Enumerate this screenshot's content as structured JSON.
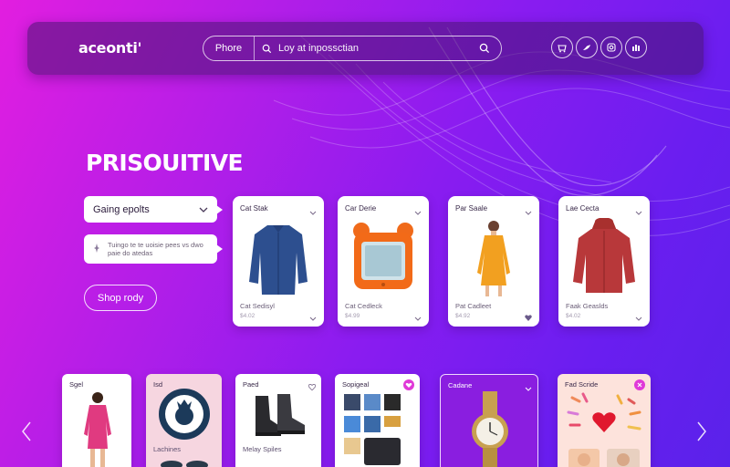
{
  "header": {
    "logo": "aceonti'",
    "search_scope": "Phore",
    "search_placeholder": "Loy at inpossctian",
    "icons": [
      "cart-icon",
      "bird-icon",
      "instagram-icon",
      "chart-icon"
    ]
  },
  "hero": {
    "title": "PRISOUITIVE",
    "select_label": "Gaing epolts",
    "note_text": "Tuingo te te uoisie pees vs dwo paie do atedas",
    "shop_button": "Shop rody"
  },
  "products": [
    {
      "title": "Cat Stak",
      "name": "Cat Sedisyl",
      "price": "$4.02",
      "icon": "blue-jacket"
    },
    {
      "title": "Car Derie",
      "name": "Cat Cedleck",
      "price": "$4.99",
      "icon": "orange-tablet"
    },
    {
      "title": "Par Saale",
      "name": "Pat Cadleet",
      "price": "$4.92",
      "icon": "orange-dress"
    },
    {
      "title": "Lae Cecta",
      "name": "Faak Geaslds",
      "price": "$4.02",
      "icon": "red-hoodie"
    }
  ],
  "bottom_cards": [
    {
      "title": "Sgel",
      "name": "",
      "theme": "white"
    },
    {
      "title": "Isd",
      "name": "Lachines",
      "theme": "pink"
    },
    {
      "title": "Paed",
      "name": "Melay Spiles",
      "theme": "white"
    },
    {
      "title": "Sopigeal",
      "name": "",
      "theme": "white"
    },
    {
      "title": "Cadane",
      "name": "",
      "theme": "purple"
    },
    {
      "title": "Fad Scride",
      "name": "",
      "theme": "peach"
    }
  ],
  "colors": {
    "accent": "#e03ad8",
    "purple": "#7a1fe8",
    "card_bg": "#ffffff"
  }
}
